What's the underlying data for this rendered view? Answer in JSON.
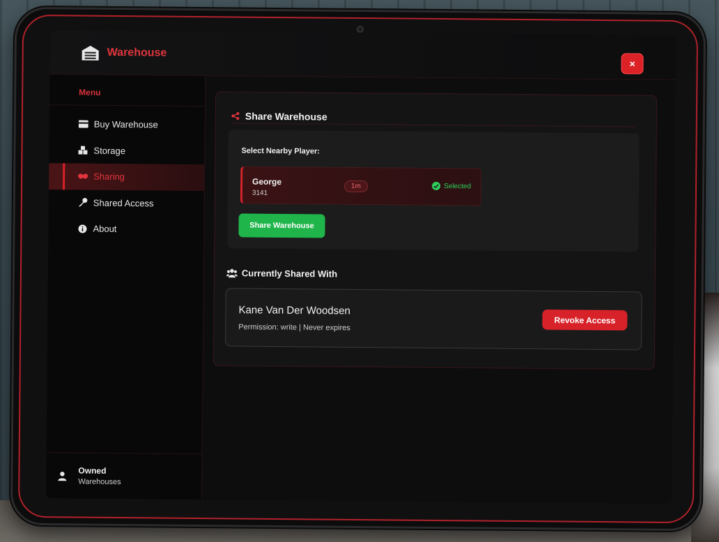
{
  "app": {
    "title": "Warehouse",
    "close_label": "×",
    "icons": {
      "logo": "warehouse-icon",
      "close": "close-icon"
    }
  },
  "colors": {
    "accent": "#dc2227",
    "success": "#1fb54a",
    "background": "#0d0d0e"
  },
  "sidebar": {
    "menu_label": "Menu",
    "items": [
      {
        "label": "Buy Warehouse",
        "icon": "credit-card-icon",
        "active": false
      },
      {
        "label": "Storage",
        "icon": "boxes-icon",
        "active": false
      },
      {
        "label": "Sharing",
        "icon": "handshake-icon",
        "active": true
      },
      {
        "label": "Shared Access",
        "icon": "key-icon",
        "active": false
      },
      {
        "label": "About",
        "icon": "info-icon",
        "active": false
      }
    ],
    "footer": {
      "title": "Owned",
      "subtitle": "Warehouses",
      "icon": "user-icon"
    }
  },
  "share_panel": {
    "title": "Share Warehouse",
    "title_icon": "share-icon",
    "select_label": "Select Nearby Player:",
    "player": {
      "name": "George",
      "id": "3141",
      "distance": "1m",
      "status": "Selected",
      "status_icon": "check-circle-icon"
    },
    "share_button": "Share Warehouse"
  },
  "shared_with": {
    "title": "Currently Shared With",
    "title_icon": "users-icon",
    "entries": [
      {
        "name": "Kane Van Der Woodsen",
        "details": "Permission: write | Never expires",
        "revoke_label": "Revoke Access"
      }
    ]
  }
}
